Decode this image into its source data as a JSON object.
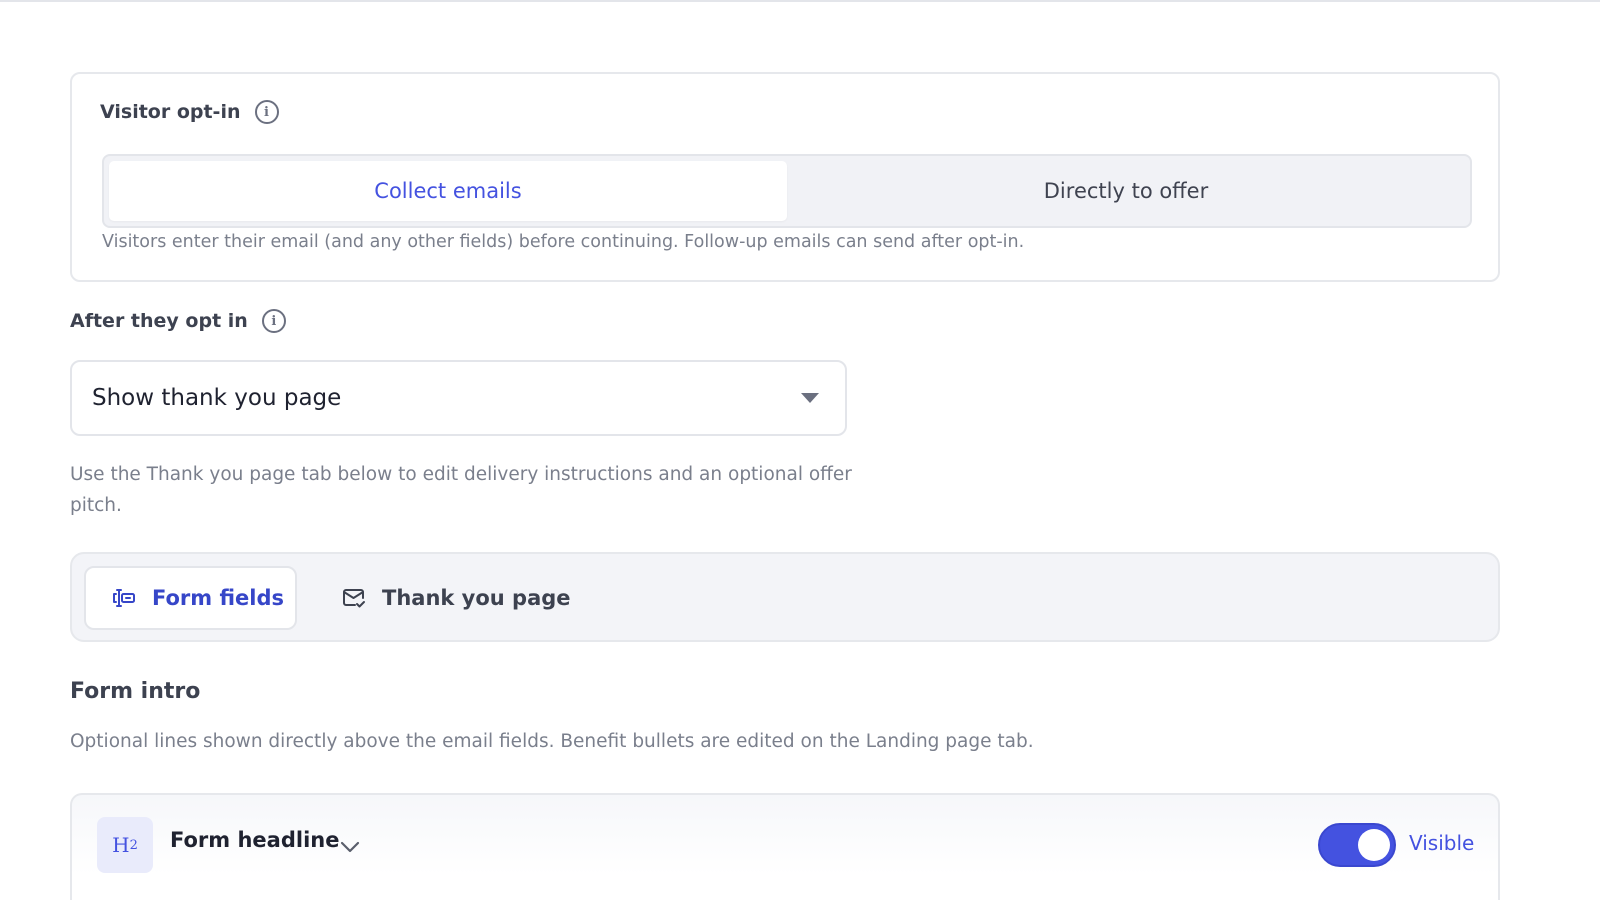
{
  "optin": {
    "label": "Visitor opt-in",
    "options": [
      "Collect emails",
      "Directly to offer"
    ],
    "selected": "Collect emails",
    "help": "Visitors enter their email (and any other fields) before continuing. Follow-up emails can send after opt-in."
  },
  "after": {
    "label": "After they opt in",
    "select_value": "Show thank you page",
    "help": "Use the Thank you page tab below to edit delivery instructions and an optional offer pitch."
  },
  "tabs": [
    {
      "label": "Form fields",
      "icon": "text-cursor-icon",
      "active": true
    },
    {
      "label": "Thank you page",
      "icon": "mail-check-icon",
      "active": false
    }
  ],
  "form_intro": {
    "title": "Form intro",
    "desc": "Optional lines shown directly above the email fields. Benefit bullets are edited on the Landing page tab."
  },
  "headline": {
    "badge": "H",
    "badge_sub": "2",
    "label": "Form headline",
    "visibility_label": "Visible",
    "visible": true
  },
  "colors": {
    "accent": "#4452e0",
    "muted_text": "#7a7f8c",
    "border": "#e6e8ec"
  }
}
